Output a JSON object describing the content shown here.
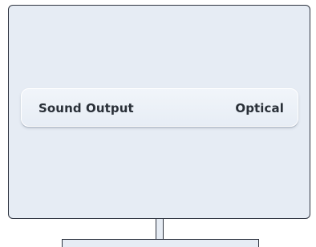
{
  "settings": {
    "sound_output": {
      "label": "Sound Output",
      "value": "Optical"
    }
  },
  "colors": {
    "screen_background": "#e6ecf4",
    "frame": "#2e3440",
    "text": "#2a3038"
  }
}
